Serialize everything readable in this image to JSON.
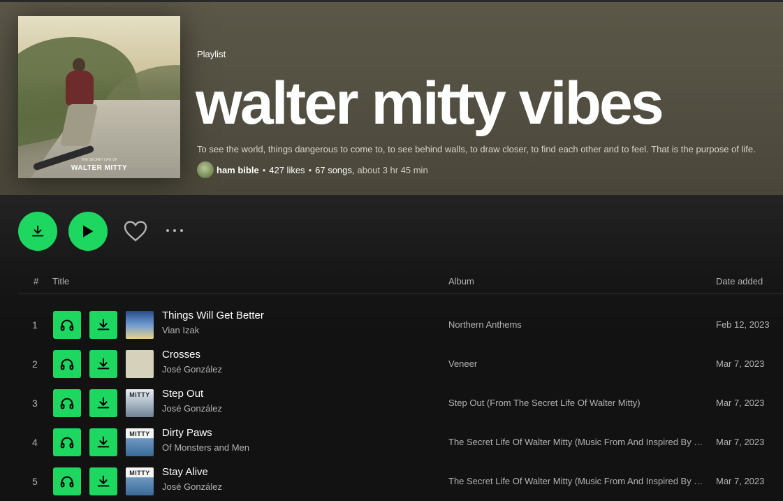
{
  "header": {
    "type_label": "Playlist",
    "title": "walter mitty vibes",
    "description": "To see the world, things dangerous to come to, to see behind walls, to draw closer, to find each other and to feel. That is the purpose of life.",
    "owner": "ham bible",
    "likes": "427 likes",
    "songs": "67 songs,",
    "duration": "about 3 hr 45 min",
    "separator": "•",
    "cover": {
      "subtitle": "THE SECRET LIFE OF",
      "title": "WALTER MITTY"
    }
  },
  "actions": {
    "download_icon": "download-icon",
    "play_icon": "play-icon",
    "like_icon": "heart-icon",
    "more_icon": "more-icon"
  },
  "table": {
    "headers": {
      "num": "#",
      "title": "Title",
      "album": "Album",
      "date": "Date added"
    },
    "rows": [
      {
        "num": "1",
        "title": "Things Will Get Better",
        "artist": "Vian Izak",
        "album": "Northern Anthems",
        "date": "Feb 12, 2023",
        "thumb_label": ""
      },
      {
        "num": "2",
        "title": "Crosses",
        "artist": "José González",
        "album": "Veneer",
        "date": "Mar 7, 2023",
        "thumb_label": ""
      },
      {
        "num": "3",
        "title": "Step Out",
        "artist": "José González",
        "album": "Step Out (From The Secret Life Of Walter Mitty)",
        "date": "Mar 7, 2023",
        "thumb_label": "MITTY"
      },
      {
        "num": "4",
        "title": "Dirty Paws",
        "artist": "Of Monsters and Men",
        "album": "The Secret Life Of Walter Mitty (Music From And Inspired By The Motion Picture)",
        "date": "Mar 7, 2023",
        "thumb_label": "MITTY"
      },
      {
        "num": "5",
        "title": "Stay Alive",
        "artist": "José González",
        "album": "The Secret Life Of Walter Mitty (Music From And Inspired By The Motion Picture)",
        "date": "Mar 7, 2023",
        "thumb_label": "MITTY"
      }
    ]
  },
  "colors": {
    "accent": "#1ed760",
    "header_bg": "#57533f",
    "bg": "#121212",
    "muted_text": "#b3b3b3"
  }
}
